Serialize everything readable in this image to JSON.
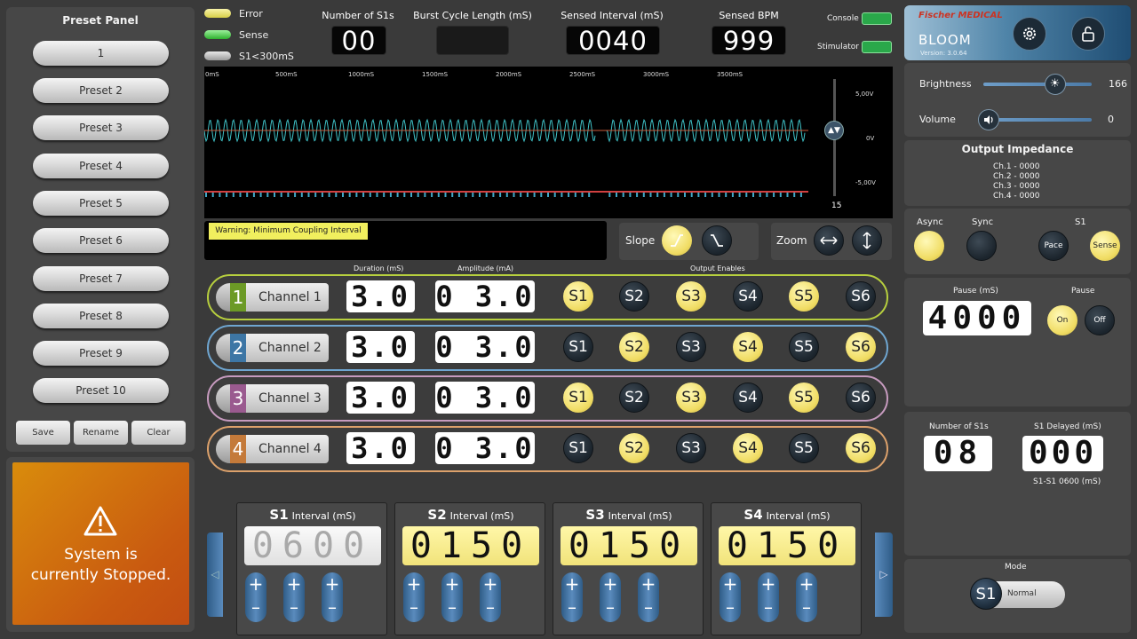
{
  "preset_panel": {
    "title": "Preset Panel",
    "presets": [
      "1",
      "Preset 2",
      "Preset 3",
      "Preset 4",
      "Preset 5",
      "Preset 6",
      "Preset 7",
      "Preset 8",
      "Preset 9",
      "Preset 10"
    ],
    "save": "Save",
    "rename": "Rename",
    "clear": "Clear"
  },
  "status": {
    "message_line1": "System is",
    "message_line2": "currently Stopped."
  },
  "legend": {
    "error": "Error",
    "sense": "Sense",
    "s1": "S1<300mS"
  },
  "metrics": {
    "num_s1_label": "Number of S1s",
    "num_s1": "00",
    "burst_label": "Burst Cycle Length (mS)",
    "burst": "",
    "sensed_interval_label": "Sensed Interval (mS)",
    "sensed_interval": "0040",
    "sensed_bpm_label": "Sensed BPM",
    "sensed_bpm": "999"
  },
  "connections": {
    "console": "Console",
    "stimulator": "Stimulator"
  },
  "brand": {
    "logo": "Fischer MEDICAL",
    "name": "BLOOM",
    "version": "Version: 3.0.64"
  },
  "scope": {
    "time_ticks": [
      "0mS",
      "500mS",
      "1000mS",
      "1500mS",
      "2000mS",
      "2500mS",
      "3000mS",
      "3500mS"
    ],
    "volt_ticks": [
      "5,00V",
      "0V",
      "-5,00V"
    ],
    "slider_value": "15"
  },
  "warning": "Warning: Minimum Coupling Interval",
  "slope_label": "Slope",
  "zoom_label": "Zoom",
  "channel_headers": {
    "duration": "Duration (mS)",
    "amplitude": "Amplitude (mA)",
    "outputs": "Output Enables"
  },
  "channels": [
    {
      "num": "1",
      "label": "Channel 1",
      "duration": "3.0",
      "amplitude": "0 3.0",
      "color": "#6c9a26",
      "border": "#b7cf3e",
      "enables": [
        true,
        false,
        true,
        false,
        true,
        false
      ]
    },
    {
      "num": "2",
      "label": "Channel 2",
      "duration": "3.0",
      "amplitude": "0 3.0",
      "color": "#3d76a5",
      "border": "#6fa6d1",
      "enables": [
        false,
        true,
        false,
        true,
        false,
        true
      ]
    },
    {
      "num": "3",
      "label": "Channel 3",
      "duration": "3.0",
      "amplitude": "0 3.0",
      "color": "#9a5a8f",
      "border": "#c79bbf",
      "enables": [
        true,
        false,
        true,
        false,
        true,
        false
      ]
    },
    {
      "num": "4",
      "label": "Channel 4",
      "duration": "3.0",
      "amplitude": "0 3.0",
      "color": "#c47a3a",
      "border": "#dca16b",
      "enables": [
        false,
        true,
        false,
        true,
        false,
        true
      ]
    }
  ],
  "output_names": [
    "S1",
    "S2",
    "S3",
    "S4",
    "S5",
    "S6"
  ],
  "intervals": [
    {
      "name": "S1",
      "label": "Interval (mS)",
      "value": "0600",
      "active": false
    },
    {
      "name": "S2",
      "label": "Interval (mS)",
      "value": "0150",
      "active": true
    },
    {
      "name": "S3",
      "label": "Interval (mS)",
      "value": "0150",
      "active": true
    },
    {
      "name": "S4",
      "label": "Interval (mS)",
      "value": "0150",
      "active": true
    }
  ],
  "settings": {
    "brightness_label": "Brightness",
    "brightness": "166",
    "brightness_level": 0.66,
    "volume_label": "Volume",
    "volume": "0",
    "volume_level": 0
  },
  "impedance": {
    "title": "Output Impedance",
    "lines": [
      "Ch.1 - 0000",
      "Ch.2 - 0000",
      "Ch.3 - 0000",
      "Ch.4 - 0000"
    ]
  },
  "mode_sync": {
    "async": "Async",
    "sync": "Sync",
    "s1": "S1",
    "pace": "Pace",
    "sense": "Sense"
  },
  "pause": {
    "label": "Pause (mS)",
    "value": "4000",
    "toggle_label": "Pause",
    "on": "On",
    "off": "Off"
  },
  "s1_settings": {
    "num_label": "Number of S1s",
    "num": "08",
    "delay_label": "S1 Delayed (mS)",
    "delay": "000",
    "s1s1": "S1-S1 0600 (mS)"
  },
  "mode": {
    "label": "Mode",
    "badge": "S1",
    "value": "Normal"
  }
}
